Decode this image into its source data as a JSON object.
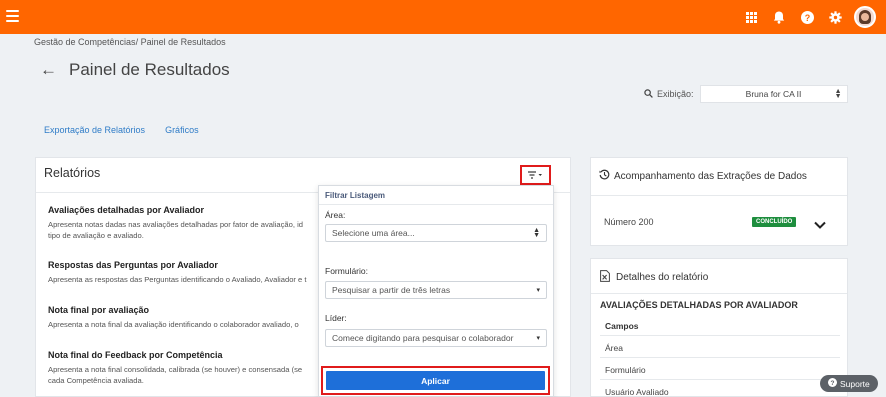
{
  "breadcrumb": {
    "item1": "Gestão de Competências",
    "sep": "/",
    "item2": "Painel de Resultados"
  },
  "page": {
    "title": "Painel de Resultados"
  },
  "exibicao": {
    "label": "Exibição:",
    "value": "Bruna for CA II"
  },
  "tabs": [
    {
      "label": "Exportação de Relatórios"
    },
    {
      "label": "Gráficos"
    }
  ],
  "reports": {
    "title": "Relatórios",
    "items": [
      {
        "title": "Avaliações detalhadas por Avaliador",
        "line1": "Apresenta notas dadas nas avaliações detalhadas por fator de avaliação, id",
        "line2": "tipo de avaliação e avaliado."
      },
      {
        "title": "Respostas das Perguntas por Avaliador",
        "line1": "Apresenta as respostas das Perguntas identificando o Avaliado, Avaliador e t",
        "line2": ""
      },
      {
        "title": "Nota final por avaliação",
        "line1": "Apresenta a nota final da avaliação identificando o colaborador avaliado, o",
        "line2": ""
      },
      {
        "title": "Nota final do Feedback por Competência",
        "line1": "Apresenta a nota final consolidada, calibrada (se houver) e consensada (se",
        "line2": "cada Competência avaliada."
      }
    ]
  },
  "filter": {
    "title": "Filtrar Listagem",
    "area_label": "Área:",
    "area_placeholder": "Selecione uma área...",
    "form_label": "Formulário:",
    "form_placeholder": "Pesquisar a partir de três letras",
    "leader_label": "Líder:",
    "leader_placeholder": "Comece digitando para pesquisar o colaborador",
    "apply_label": "Aplicar"
  },
  "extracoes": {
    "title": "Acompanhamento das Extrações de Dados",
    "row_label": "Número 200",
    "status": "CONCLUÍDO"
  },
  "detalhes": {
    "title": "Detalhes do relatório",
    "heading": "AVALIAÇÕES DETALHADAS POR AVALIADOR",
    "fields_header": "Campos",
    "fields": [
      "Área",
      "Formulário",
      "Usuário Avaliado"
    ]
  },
  "support": {
    "label": "Suporte"
  },
  "colors": {
    "topbar": "#ff6600",
    "link": "#2f7cc7",
    "primary": "#1e6fd9",
    "success": "#1e8e3e",
    "highlight": "#e01b1b"
  },
  "icons": [
    "menu-icon",
    "apps-grid-icon",
    "bell-icon",
    "help-icon",
    "gear-icon",
    "back-arrow-icon",
    "search-icon",
    "filter-icon",
    "history-icon",
    "chevron-down-icon",
    "excel-file-icon",
    "question-circle-icon"
  ]
}
